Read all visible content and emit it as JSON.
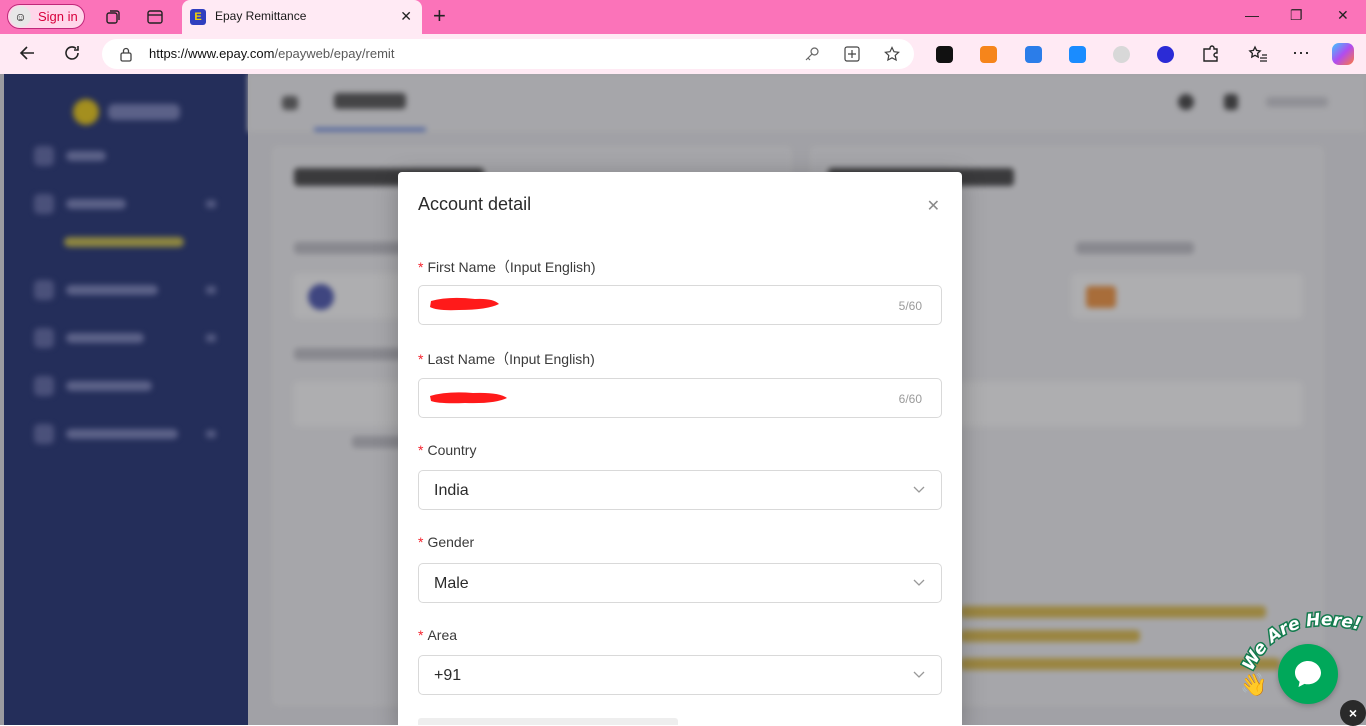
{
  "browser": {
    "sign_in": "Sign in",
    "tab_title": "Epay Remittance",
    "url_host": "https://www.epay.com",
    "url_path": "/epayweb/epay/remit"
  },
  "modal": {
    "title": "Account detail",
    "fields": [
      {
        "label": "First Name（Input English)",
        "value": "",
        "counter": "5/60"
      },
      {
        "label": "Last Name（Input English)",
        "value": "",
        "counter": "6/60"
      },
      {
        "label": "Country",
        "value": "India"
      },
      {
        "label": "Gender",
        "value": "Male"
      },
      {
        "label": "Area",
        "value": "+91"
      }
    ],
    "required_mark": "*"
  },
  "chat_widget": {
    "banner": "We Are Here!",
    "dismiss": "×"
  },
  "colors": {
    "tab_strip": "#fb73b9",
    "toolbar": "#ffeaf4",
    "sidebar": "#0d1e66",
    "chat": "#00a85a",
    "required": "#f5222d"
  }
}
